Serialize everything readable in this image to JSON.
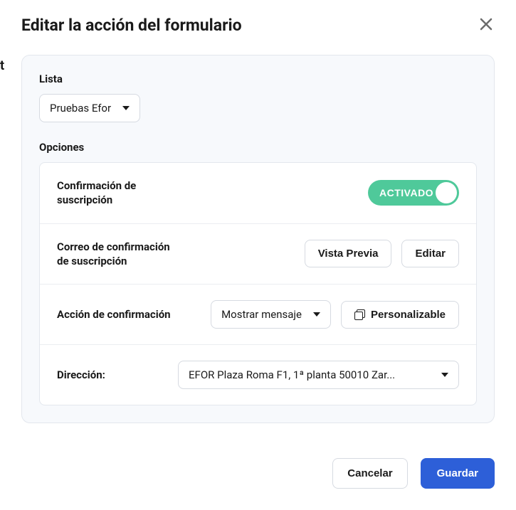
{
  "modal": {
    "title": "Editar la acción del formulario",
    "list": {
      "label": "Lista",
      "selected": "Pruebas Efor"
    },
    "options": {
      "label": "Opciones",
      "subscription_confirmation": {
        "label": "Confirmación de suscripción",
        "toggle_state": "ACTIVADO"
      },
      "confirmation_email": {
        "label": "Correo de confirmación de suscripción",
        "preview_btn": "Vista Previa",
        "edit_btn": "Editar"
      },
      "confirmation_action": {
        "label": "Acción de confirmación",
        "selected": "Mostrar mensaje",
        "customize_btn": "Personalizable"
      },
      "address": {
        "label": "Dirección:",
        "selected": "EFOR Plaza Roma F1, 1ª planta 50010 Zar..."
      }
    },
    "footer": {
      "cancel": "Cancelar",
      "save": "Guardar"
    }
  },
  "edge_char": "t"
}
